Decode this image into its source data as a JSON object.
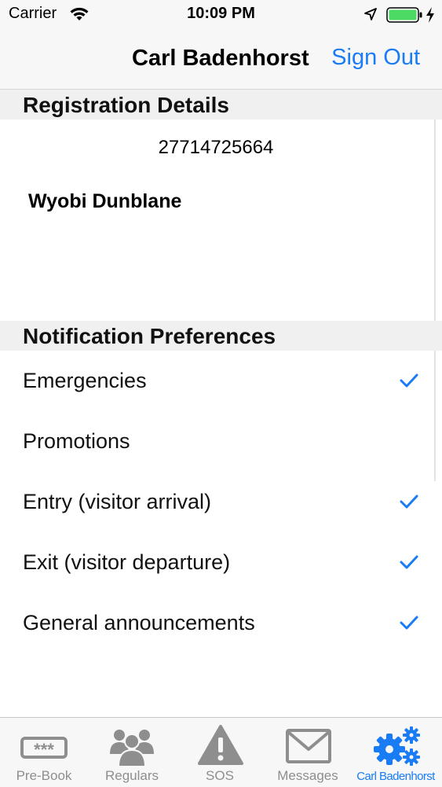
{
  "status_bar": {
    "carrier": "Carrier",
    "time": "10:09 PM",
    "icons": [
      "wifi-icon",
      "location-arrow-icon",
      "battery-icon",
      "charging-bolt-icon"
    ],
    "battery_color": "#4cd964"
  },
  "nav": {
    "title": "Carl Badenhorst",
    "sign_out": "Sign Out"
  },
  "registration": {
    "header": "Registration Details",
    "phone": "27714725664",
    "estate": "Wyobi Dunblane"
  },
  "notifications": {
    "header": "Notification Preferences",
    "items": [
      {
        "label": "Emergencies",
        "checked": true
      },
      {
        "label": "Promotions",
        "checked": false
      },
      {
        "label": "Entry (visitor arrival)",
        "checked": true
      },
      {
        "label": "Exit (visitor departure)",
        "checked": true
      },
      {
        "label": "General announcements",
        "checked": true
      }
    ]
  },
  "tabs": [
    {
      "label": "Pre-Book",
      "icon": "keypad-icon",
      "active": false
    },
    {
      "label": "Regulars",
      "icon": "group-icon",
      "active": false
    },
    {
      "label": "SOS",
      "icon": "warning-icon",
      "active": false
    },
    {
      "label": "Messages",
      "icon": "envelope-icon",
      "active": false
    },
    {
      "label": "Carl Badenhorst",
      "icon": "gears-icon",
      "active": true
    }
  ],
  "colors": {
    "accent": "#1a7cf5",
    "inactive_tab": "#8e8e8e",
    "section_header_bg": "#f0f0f0"
  }
}
